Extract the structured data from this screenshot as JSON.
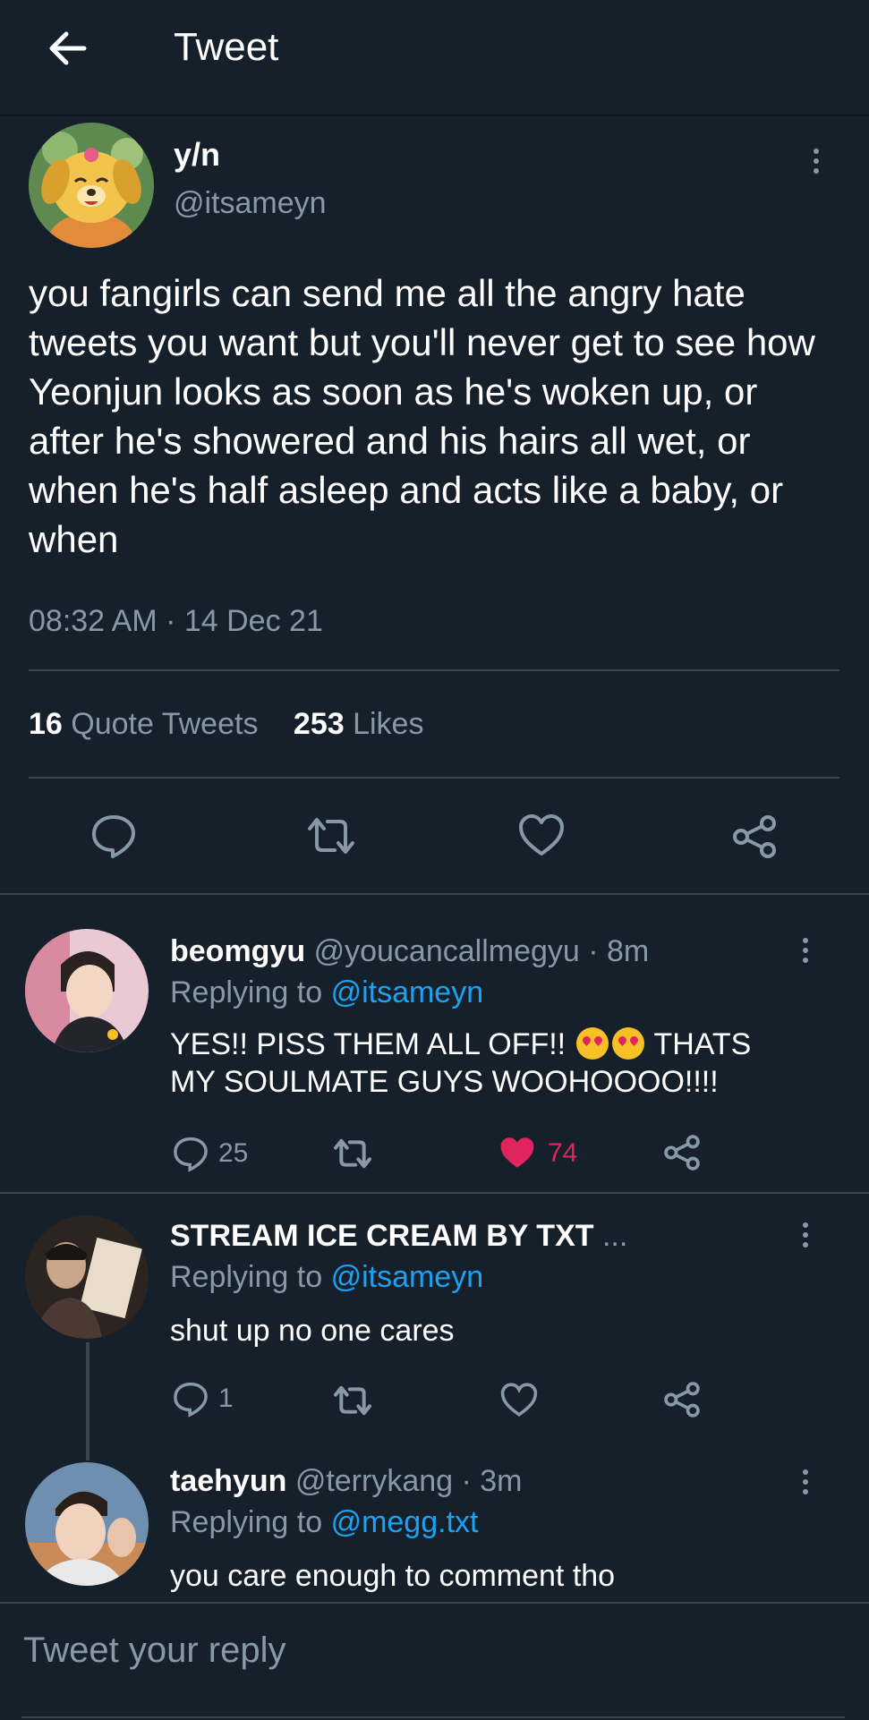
{
  "header": {
    "title": "Tweet"
  },
  "main_tweet": {
    "display_name": "y/n",
    "handle": "@itsameyn",
    "text": "you fangirls can send me all the angry hate tweets you want but you'll never get to see how Yeonjun looks as soon as he's woken up, or after he's showered and his hairs all wet, or when he's half asleep and acts like a baby, or when",
    "timestamp": "08:32 AM · 14 Dec 21",
    "quote_count": "16",
    "quote_label": "Quote Tweets",
    "like_count": "253",
    "like_label": "Likes",
    "icons": [
      "reply-icon",
      "retweet-icon",
      "like-icon",
      "share-icon"
    ]
  },
  "replies": [
    {
      "display_name": "beomgyu",
      "handle_time": "@youcancallmegyu · 8m",
      "replying_prefix": "Replying to",
      "replying_to": "@itsameyn",
      "text_part1": "YES!! PISS THEM ALL OFF!!",
      "text_part2": "THATS",
      "text_line2": "MY SOULMATE GUYS WOOHOOOO!!!!",
      "reply_count": "25",
      "like_count": "74",
      "liked": true
    },
    {
      "display_name": "STREAM ICE CREAM BY TXT",
      "truncation": "...",
      "replying_prefix": "Replying to",
      "replying_to": "@itsameyn",
      "text": "shut up no one cares",
      "reply_count": "1"
    },
    {
      "display_name": "taehyun",
      "handle_time": "@terrykang · 3m",
      "replying_prefix": "Replying to",
      "replying_to": "@megg.txt",
      "text": "you care enough to comment tho"
    }
  ],
  "reply_box": {
    "placeholder": "Tweet your reply"
  },
  "colors": {
    "background": "#15202b",
    "accent": "#1da1f2",
    "like": "#e0245e",
    "muted": "#8899a6"
  }
}
